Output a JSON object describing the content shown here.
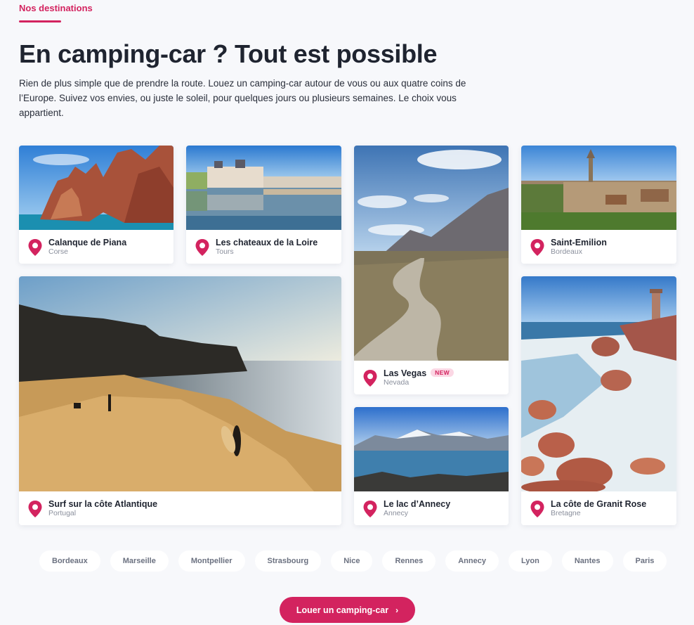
{
  "section": {
    "eyebrow": "Nos destinations",
    "title": "En camping-car ? Tout est possible",
    "intro": "Rien de plus simple que de prendre la route. Louez un camping-car autour de vous ou aux quatre coins de l’Europe. Suivez vos envies, ou juste le soleil, pour quelques jours ou plusieurs semaines. Le choix vous appartient."
  },
  "destinations": [
    {
      "title": "Calanque de Piana",
      "subtitle": "Corse"
    },
    {
      "title": "Les chateaux de la Loire",
      "subtitle": "Tours"
    },
    {
      "title": "Las Vegas",
      "subtitle": "Nevada",
      "badge": "NEW"
    },
    {
      "title": "Saint-Emilion",
      "subtitle": "Bordeaux"
    },
    {
      "title": "Surf sur la côte Atlantique",
      "subtitle": "Portugal"
    },
    {
      "title": "Le lac d’Annecy",
      "subtitle": "Annecy"
    },
    {
      "title": "La côte de Granit Rose",
      "subtitle": "Bretagne"
    }
  ],
  "cities": [
    "Bordeaux",
    "Marseille",
    "Montpellier",
    "Strasbourg",
    "Nice",
    "Rennes",
    "Annecy",
    "Lyon",
    "Nantes",
    "Paris"
  ],
  "cta": {
    "label": "Louer un camping-car",
    "icon": "chevron-right-icon"
  },
  "colors": {
    "accent": "#d3235f",
    "background": "#f7f8fb"
  }
}
